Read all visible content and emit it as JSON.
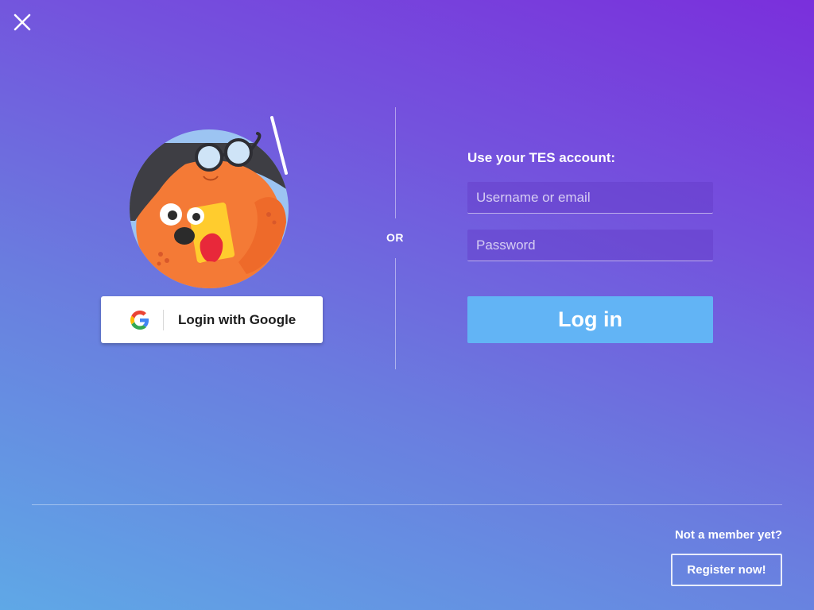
{
  "window": {
    "close_icon": "close-icon"
  },
  "mascot": {
    "icon": "teacher-mascot-illustration"
  },
  "google_login": {
    "icon": "google-g-icon",
    "label": "Login with Google"
  },
  "divider": {
    "label": "OR"
  },
  "tes_login": {
    "heading": "Use your TES account:",
    "username_placeholder": "Username or email",
    "username_value": "",
    "password_placeholder": "Password",
    "password_value": "",
    "submit_label": "Log in"
  },
  "footer": {
    "prompt": "Not a member yet?",
    "register_label": "Register now!"
  },
  "colors": {
    "gradient_top_right": "#7a2fdc",
    "gradient_bottom_left": "#5fa8e6",
    "login_button": "#62b4f5",
    "google_button": "#ffffff"
  }
}
